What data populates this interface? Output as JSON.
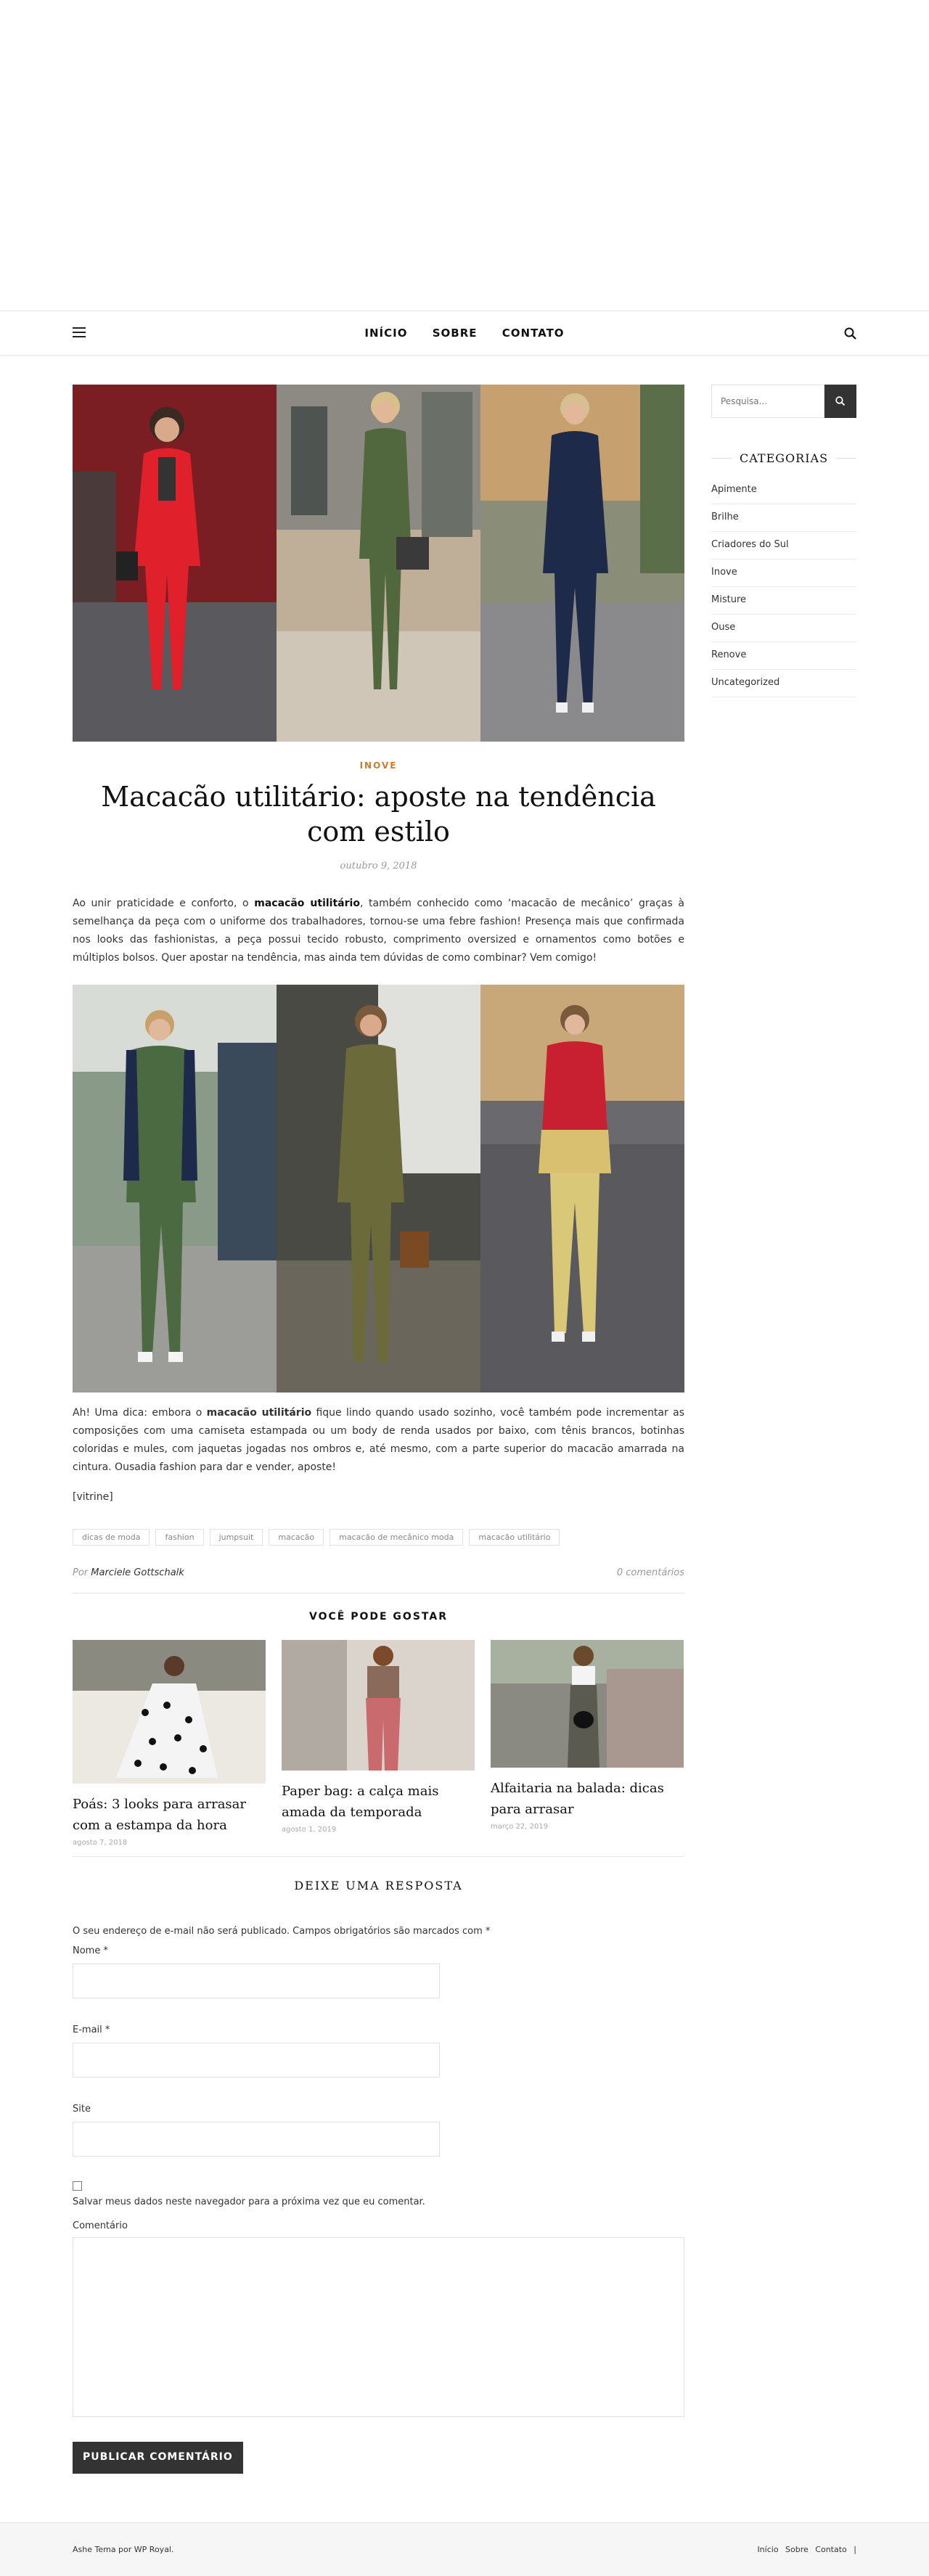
{
  "nav": {
    "items": [
      "INÍCIO",
      "SOBRE",
      "CONTATO"
    ]
  },
  "post": {
    "category": "INOVE",
    "title": "Macacão utilitário: aposte na tendência com estilo",
    "date": "outubro 9, 2018",
    "intro_1": "Ao unir praticidade e conforto, o ",
    "intro_bold": "macacão utilitário",
    "intro_2": ", também conhecido como ‘macacão de mecânico’ graças à semelhança da peça com o uniforme dos trabalhadores, tornou-se uma febre fashion! Presença mais que confirmada nos looks das fashionistas, a peça possui tecido robusto, comprimento oversized e ornamentos como botões e múltiplos bolsos. Quer apostar na tendência, mas ainda tem dúvidas de como combinar? Vem comigo!",
    "tip_1": "Ah! Uma dica: embora o ",
    "tip_bold": "macacão utilitário",
    "tip_2": " fique lindo quando usado sozinho, você também pode incrementar as composições com uma camiseta estampada ou um body de renda usados por baixo, com tênis brancos, botinhas coloridas e mules, com jaquetas jogadas nos ombros e, até mesmo, com a parte superior do macacão amarrada na cintura. Ousadia fashion para dar e vender, aposte!",
    "vitrine": "[vitrine]",
    "tags": [
      "dicas de moda",
      "fashion",
      "jumpsuit",
      "macacão",
      "macacão de mecânico moda",
      "macacão utilitário"
    ],
    "by": "Por",
    "author": "Marciele Gottschalk",
    "comments": "0 comentários"
  },
  "related": {
    "heading": "VOCÊ PODE GOSTAR",
    "items": [
      {
        "title": "Poás: 3 looks para arrasar com a estampa da hora",
        "date": "agosto 7, 2018"
      },
      {
        "title": "Paper bag: a calça mais amada da temporada",
        "date": "agosto 1, 2019"
      },
      {
        "title": "Alfaitaria na balada: dicas para arrasar",
        "date": "março 22, 2019"
      }
    ]
  },
  "reply": {
    "heading": "DEIXE UMA RESPOSTA",
    "note": "O seu endereço de e-mail não será publicado. Campos obrigatórios são marcados com *",
    "name_label": "Nome *",
    "email_label": "E-mail *",
    "site_label": "Site",
    "save_label": "Salvar meus dados neste navegador para a próxima vez que eu comentar.",
    "comment_label": "Comentário",
    "submit": "PUBLICAR COMENTÁRIO"
  },
  "sidebar": {
    "search_placeholder": "Pesquisa...",
    "categories_heading": "CATEGORIAS",
    "categories": [
      "Apimente",
      "Brilhe",
      "Criadores do Sul",
      "Inove",
      "Misture",
      "Ouse",
      "Renove",
      "Uncategorized"
    ]
  },
  "footer": {
    "credit": "Ashe Tema por WP Royal.",
    "links": [
      "Início",
      "Sobre",
      "Contato"
    ],
    "separator": "|"
  },
  "colors": {
    "accent": "#c87d32",
    "dark": "#333333"
  }
}
